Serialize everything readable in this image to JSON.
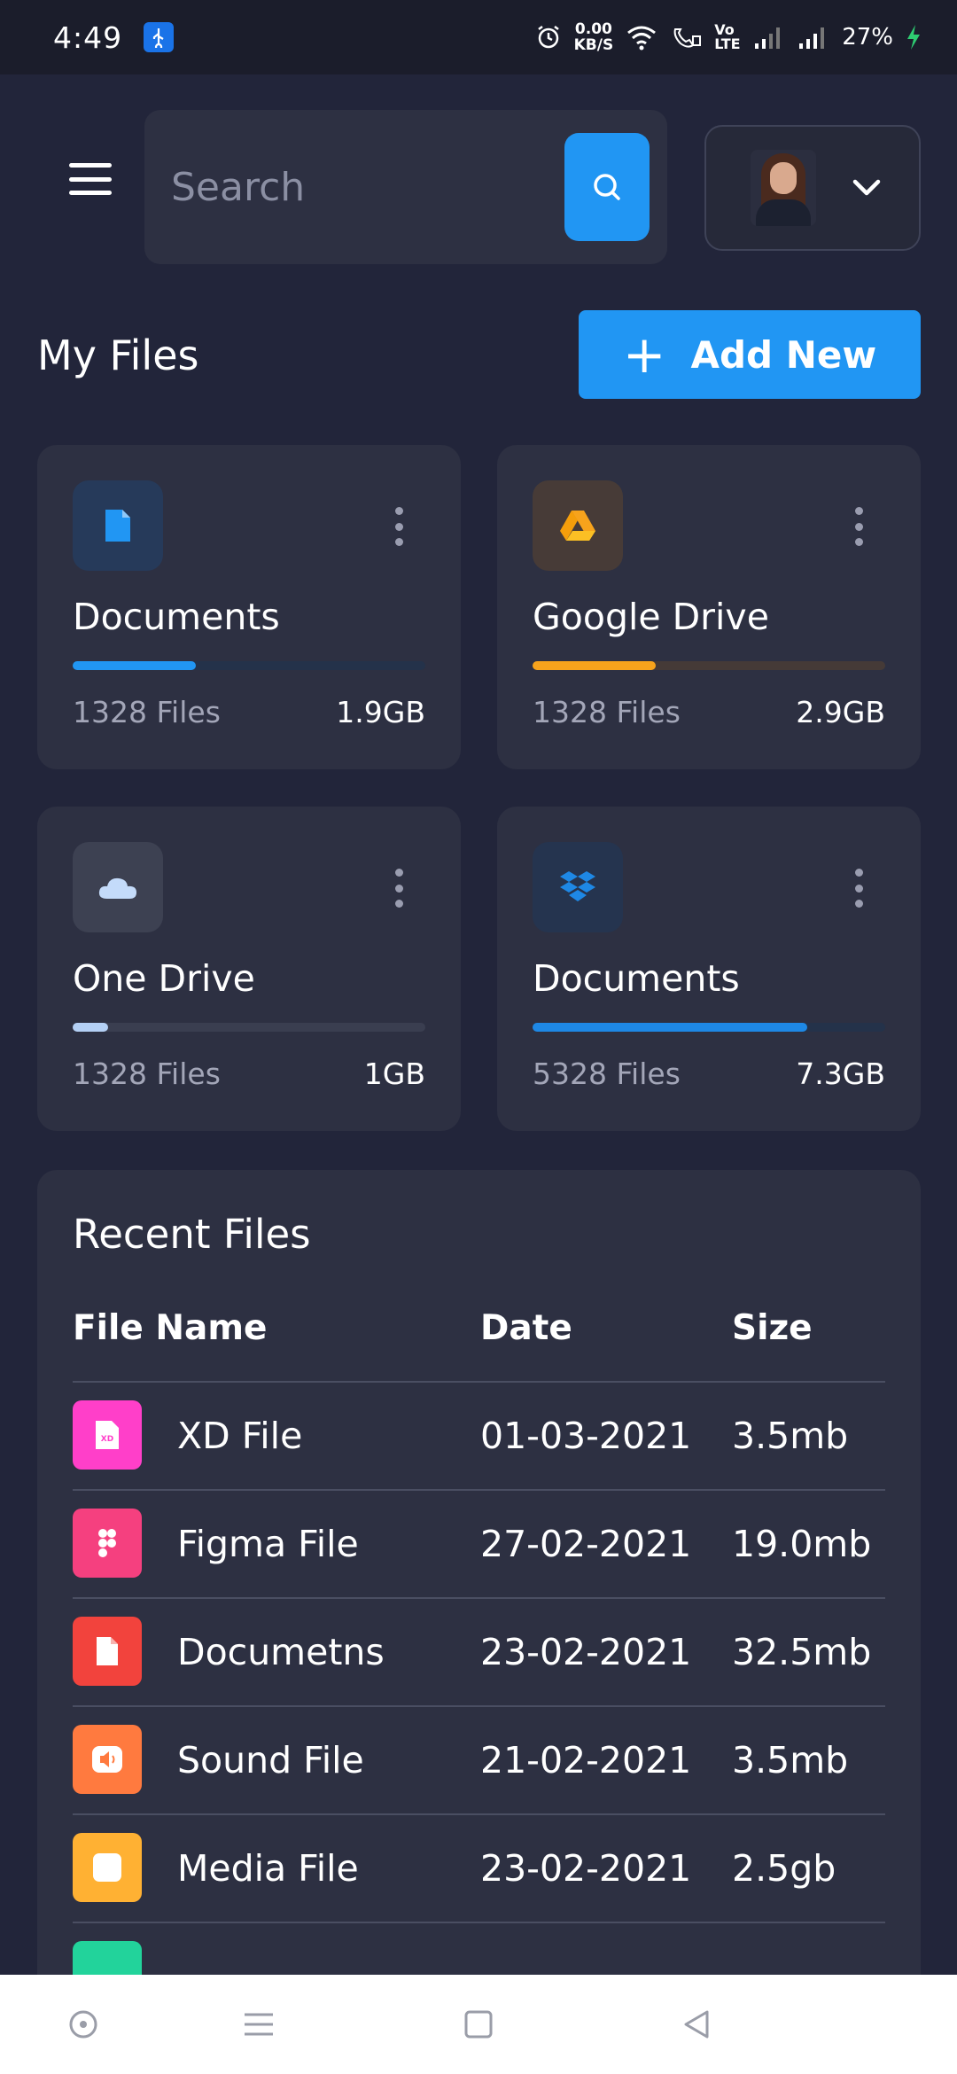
{
  "status_bar": {
    "time": "4:49",
    "net_speed_value": "0.00",
    "net_speed_unit": "KB/S",
    "volte": "Vo LTE",
    "battery": "27%"
  },
  "header": {
    "search_placeholder": "Search"
  },
  "my_files": {
    "title": "My Files",
    "add_button": "Add New",
    "cards": [
      {
        "title": "Documents",
        "count": "1328 Files",
        "size": "1.9GB",
        "progress": 0.35,
        "icon": "document-icon",
        "accent": "#2196f3",
        "icon_bg": "#263a5a",
        "track": "#24324a"
      },
      {
        "title": "Google Drive",
        "count": "1328 Files",
        "size": "2.9GB",
        "progress": 0.35,
        "icon": "google-drive-icon",
        "accent": "#f7a31c",
        "icon_bg": "#473b37",
        "track": "#453a37"
      },
      {
        "title": "One Drive",
        "count": "1328 Files",
        "size": "1GB",
        "progress": 0.1,
        "icon": "cloud-icon",
        "accent": "#b4d0f5",
        "icon_bg": "#3d4152",
        "track": "#3a3e50"
      },
      {
        "title": "Documents",
        "count": "5328 Files",
        "size": "7.3GB",
        "progress": 0.78,
        "icon": "dropbox-icon",
        "accent": "#1e88e5",
        "icon_bg": "#25344f",
        "track": "#24324a"
      }
    ]
  },
  "recent_files": {
    "title": "Recent Files",
    "columns": [
      "File Name",
      "Date",
      "Size"
    ],
    "rows": [
      {
        "name": "XD File",
        "date": "01-03-2021",
        "size": "3.5mb",
        "icon": "xd-file-icon",
        "color": "#ff3fc9"
      },
      {
        "name": "Figma File",
        "date": "27-02-2021",
        "size": "19.0mb",
        "icon": "figma-icon",
        "color": "#f5407f"
      },
      {
        "name": "Documetns",
        "date": "23-02-2021",
        "size": "32.5mb",
        "icon": "document-icon",
        "color": "#f2433d"
      },
      {
        "name": "Sound File",
        "date": "21-02-2021",
        "size": "3.5mb",
        "icon": "sound-icon",
        "color": "#ff7a3f"
      },
      {
        "name": "Media File",
        "date": "23-02-2021",
        "size": "2.5gb",
        "icon": "media-icon",
        "color": "#ffb133"
      },
      {
        "name": "",
        "date": "",
        "size": "",
        "icon": "file-icon",
        "color": "#22d39b"
      }
    ]
  }
}
